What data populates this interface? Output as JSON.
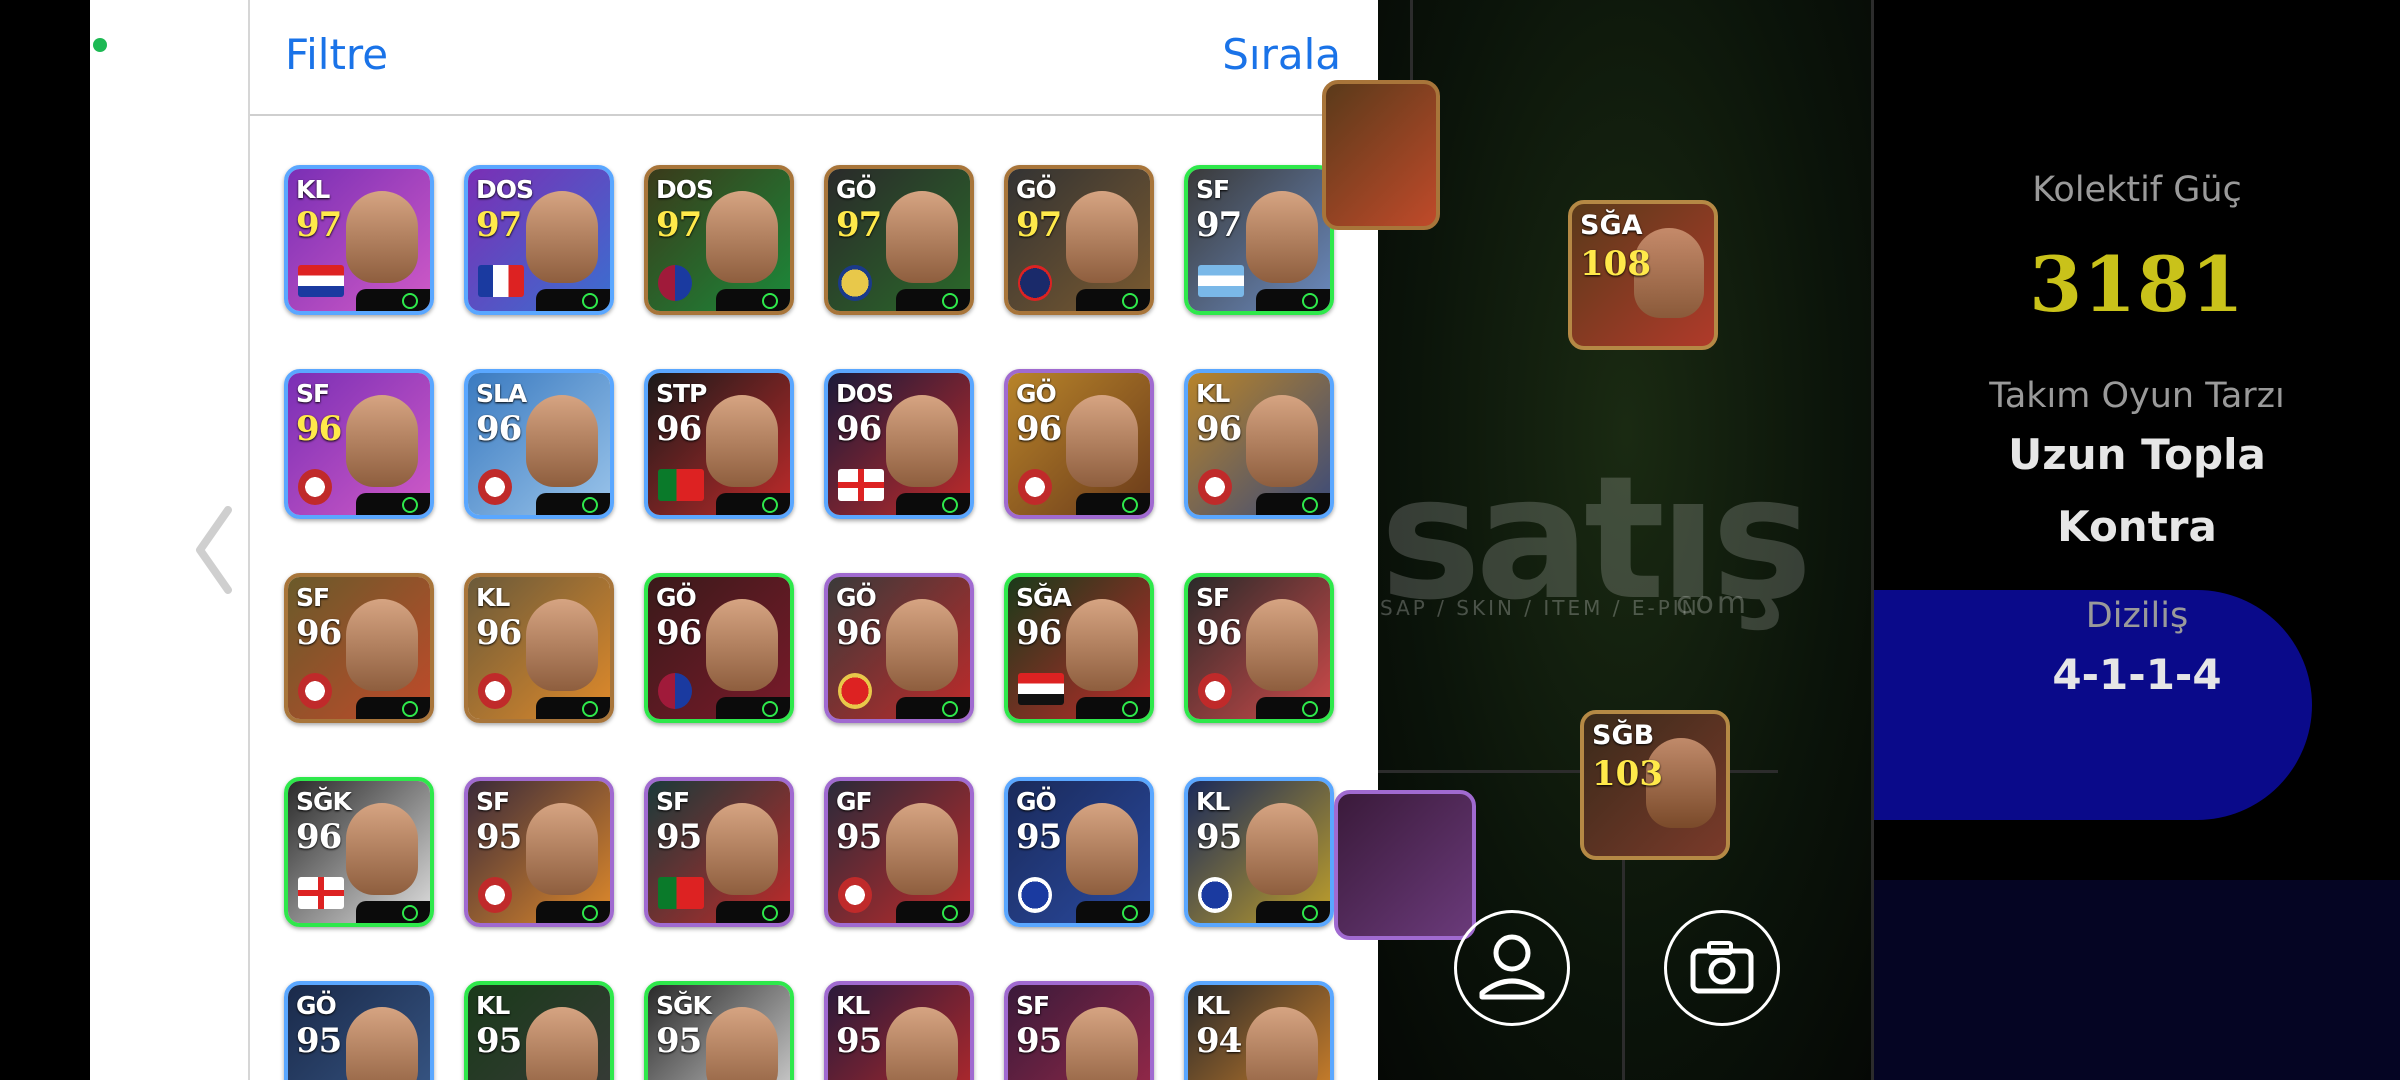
{
  "header": {
    "filter_label": "Filtre",
    "sort_label": "Sırala"
  },
  "players": [
    {
      "pos": "KL",
      "rating": "97",
      "rating_color": "yellow",
      "border": "#5aa7ff",
      "bg": [
        "#7a2fb5",
        "#d05ac7"
      ],
      "flag": "croatia"
    },
    {
      "pos": "DOS",
      "rating": "97",
      "rating_color": "yellow",
      "border": "#5aa7ff",
      "bg": [
        "#7a2fb5",
        "#3a6fd0"
      ],
      "flag": "france"
    },
    {
      "pos": "DOS",
      "rating": "97",
      "rating_color": "yellow",
      "border": "#a8753a",
      "bg": [
        "#3a3a1a",
        "#1b8a3a"
      ],
      "flag": "barca"
    },
    {
      "pos": "GÖ",
      "rating": "97",
      "rating_color": "yellow",
      "border": "#a8753a",
      "bg": [
        "#2a2a2a",
        "#2a6a2a"
      ],
      "flag": "lau"
    },
    {
      "pos": "GÖ",
      "rating": "97",
      "rating_color": "yellow",
      "border": "#a8753a",
      "bg": [
        "#333",
        "#7a5a30"
      ],
      "flag": "psg"
    },
    {
      "pos": "SF",
      "rating": "97",
      "rating_color": "white",
      "border": "#2ee84b",
      "bg": [
        "#3a3a3a",
        "#6b8bc0"
      ],
      "flag": "argentina"
    },
    {
      "pos": "SF",
      "rating": "96",
      "rating_color": "yellow",
      "border": "#5aa7ff",
      "bg": [
        "#7a2fb5",
        "#d05ac7"
      ],
      "flag": "club"
    },
    {
      "pos": "SLA",
      "rating": "96",
      "rating_color": "white",
      "border": "#5aa7ff",
      "bg": [
        "#3a7ac0",
        "#9ac4ea"
      ],
      "flag": "club"
    },
    {
      "pos": "STP",
      "rating": "96",
      "rating_color": "white",
      "border": "#5aa7ff",
      "bg": [
        "#1a1a1a",
        "#c02a2a"
      ],
      "flag": "portugal"
    },
    {
      "pos": "DOS",
      "rating": "96",
      "rating_color": "white",
      "border": "#5aa7ff",
      "bg": [
        "#1a1a3a",
        "#c02a2a"
      ],
      "flag": "england"
    },
    {
      "pos": "GÖ",
      "rating": "96",
      "rating_color": "white",
      "border": "#a06ad0",
      "bg": [
        "#b8842a",
        "#6a3a1a"
      ],
      "flag": "club"
    },
    {
      "pos": "KL",
      "rating": "96",
      "rating_color": "white",
      "border": "#5aa7ff",
      "bg": [
        "#b8842a",
        "#3a4a7a"
      ],
      "flag": "club"
    },
    {
      "pos": "SF",
      "rating": "96",
      "rating_color": "white",
      "border": "#a8753a",
      "bg": [
        "#6a5a2a",
        "#c04a2a"
      ],
      "flag": "club"
    },
    {
      "pos": "KL",
      "rating": "96",
      "rating_color": "white",
      "border": "#a8753a",
      "bg": [
        "#6a5a3a",
        "#e08a2a"
      ],
      "flag": "club"
    },
    {
      "pos": "GÖ",
      "rating": "96",
      "rating_color": "white",
      "border": "#2ee84b",
      "bg": [
        "#3a1a1a",
        "#7a1a2a"
      ],
      "flag": "barca"
    },
    {
      "pos": "GÖ",
      "rating": "96",
      "rating_color": "white",
      "border": "#a06ad0",
      "bg": [
        "#3a3a3a",
        "#c02a2a"
      ],
      "flag": "arsenal"
    },
    {
      "pos": "SĞA",
      "rating": "96",
      "rating_color": "white",
      "border": "#2ee84b",
      "bg": [
        "#1a3a1a",
        "#c02a2a"
      ],
      "flag": "egypt"
    },
    {
      "pos": "SF",
      "rating": "96",
      "rating_color": "white",
      "border": "#2ee84b",
      "bg": [
        "#2a2a2a",
        "#d04a4a"
      ],
      "flag": "club"
    },
    {
      "pos": "SĞK",
      "rating": "96",
      "rating_color": "white",
      "border": "#2ee84b",
      "bg": [
        "#2a2a2a",
        "#e0e0e0"
      ],
      "flag": "england"
    },
    {
      "pos": "SF",
      "rating": "95",
      "rating_color": "white",
      "border": "#a06ad0",
      "bg": [
        "#3a2a3a",
        "#e08a2a"
      ],
      "flag": "club"
    },
    {
      "pos": "SF",
      "rating": "95",
      "rating_color": "white",
      "border": "#a06ad0",
      "bg": [
        "#1a3a3a",
        "#c02a2a"
      ],
      "flag": "portugal"
    },
    {
      "pos": "GF",
      "rating": "95",
      "rating_color": "white",
      "border": "#a06ad0",
      "bg": [
        "#2a2a3a",
        "#c02a2a"
      ],
      "flag": "club"
    },
    {
      "pos": "GÖ",
      "rating": "95",
      "rating_color": "white",
      "border": "#5aa7ff",
      "bg": [
        "#1a2a5a",
        "#2a4aa0"
      ],
      "flag": "inter"
    },
    {
      "pos": "KL",
      "rating": "95",
      "rating_color": "white",
      "border": "#5aa7ff",
      "bg": [
        "#1a2a5a",
        "#c0a02a"
      ],
      "flag": "inter"
    },
    {
      "pos": "GÖ",
      "rating": "95",
      "rating_color": "white",
      "border": "#5aa7ff",
      "bg": [
        "#1a2a4a",
        "#3a5a8a"
      ],
      "flag": "none"
    },
    {
      "pos": "KL",
      "rating": "95",
      "rating_color": "white",
      "border": "#2ee84b",
      "bg": [
        "#1a3a1a",
        "#3a3a3a"
      ],
      "flag": "none"
    },
    {
      "pos": "SĞK",
      "rating": "95",
      "rating_color": "white",
      "border": "#2ee84b",
      "bg": [
        "#2a2a2a",
        "#e0e0e0"
      ],
      "flag": "none"
    },
    {
      "pos": "KL",
      "rating": "95",
      "rating_color": "white",
      "border": "#a06ad0",
      "bg": [
        "#2a1a3a",
        "#c02a2a"
      ],
      "flag": "none"
    },
    {
      "pos": "SF",
      "rating": "95",
      "rating_color": "white",
      "border": "#a06ad0",
      "bg": [
        "#3a1a3a",
        "#a02a4a"
      ],
      "flag": "none"
    },
    {
      "pos": "KL",
      "rating": "94",
      "rating_color": "white",
      "border": "#5aa7ff",
      "bg": [
        "#2a2a2a",
        "#e08a2a"
      ],
      "flag": "none"
    }
  ],
  "pitch_cards": [
    {
      "pos": "SĞA",
      "rating": "108"
    },
    {
      "pos": "SĞB",
      "rating": "103"
    }
  ],
  "stats": {
    "collective_power_label": "Kolektif Güç",
    "collective_power_value": "3181",
    "team_style_label": "Takım Oyun Tarzı",
    "team_style_value_1": "Uzun Topla",
    "team_style_value_2": "Kontra",
    "formation_label": "Diziliş",
    "formation_value": "4-1-1-4"
  },
  "watermark": {
    "main": "satış",
    "sub": "SAP / SKIN / ITEM / E-PIN",
    "com": "com"
  },
  "icons": {
    "back": "chevron-left-icon",
    "profile": "person-icon",
    "camera": "camera-icon"
  }
}
